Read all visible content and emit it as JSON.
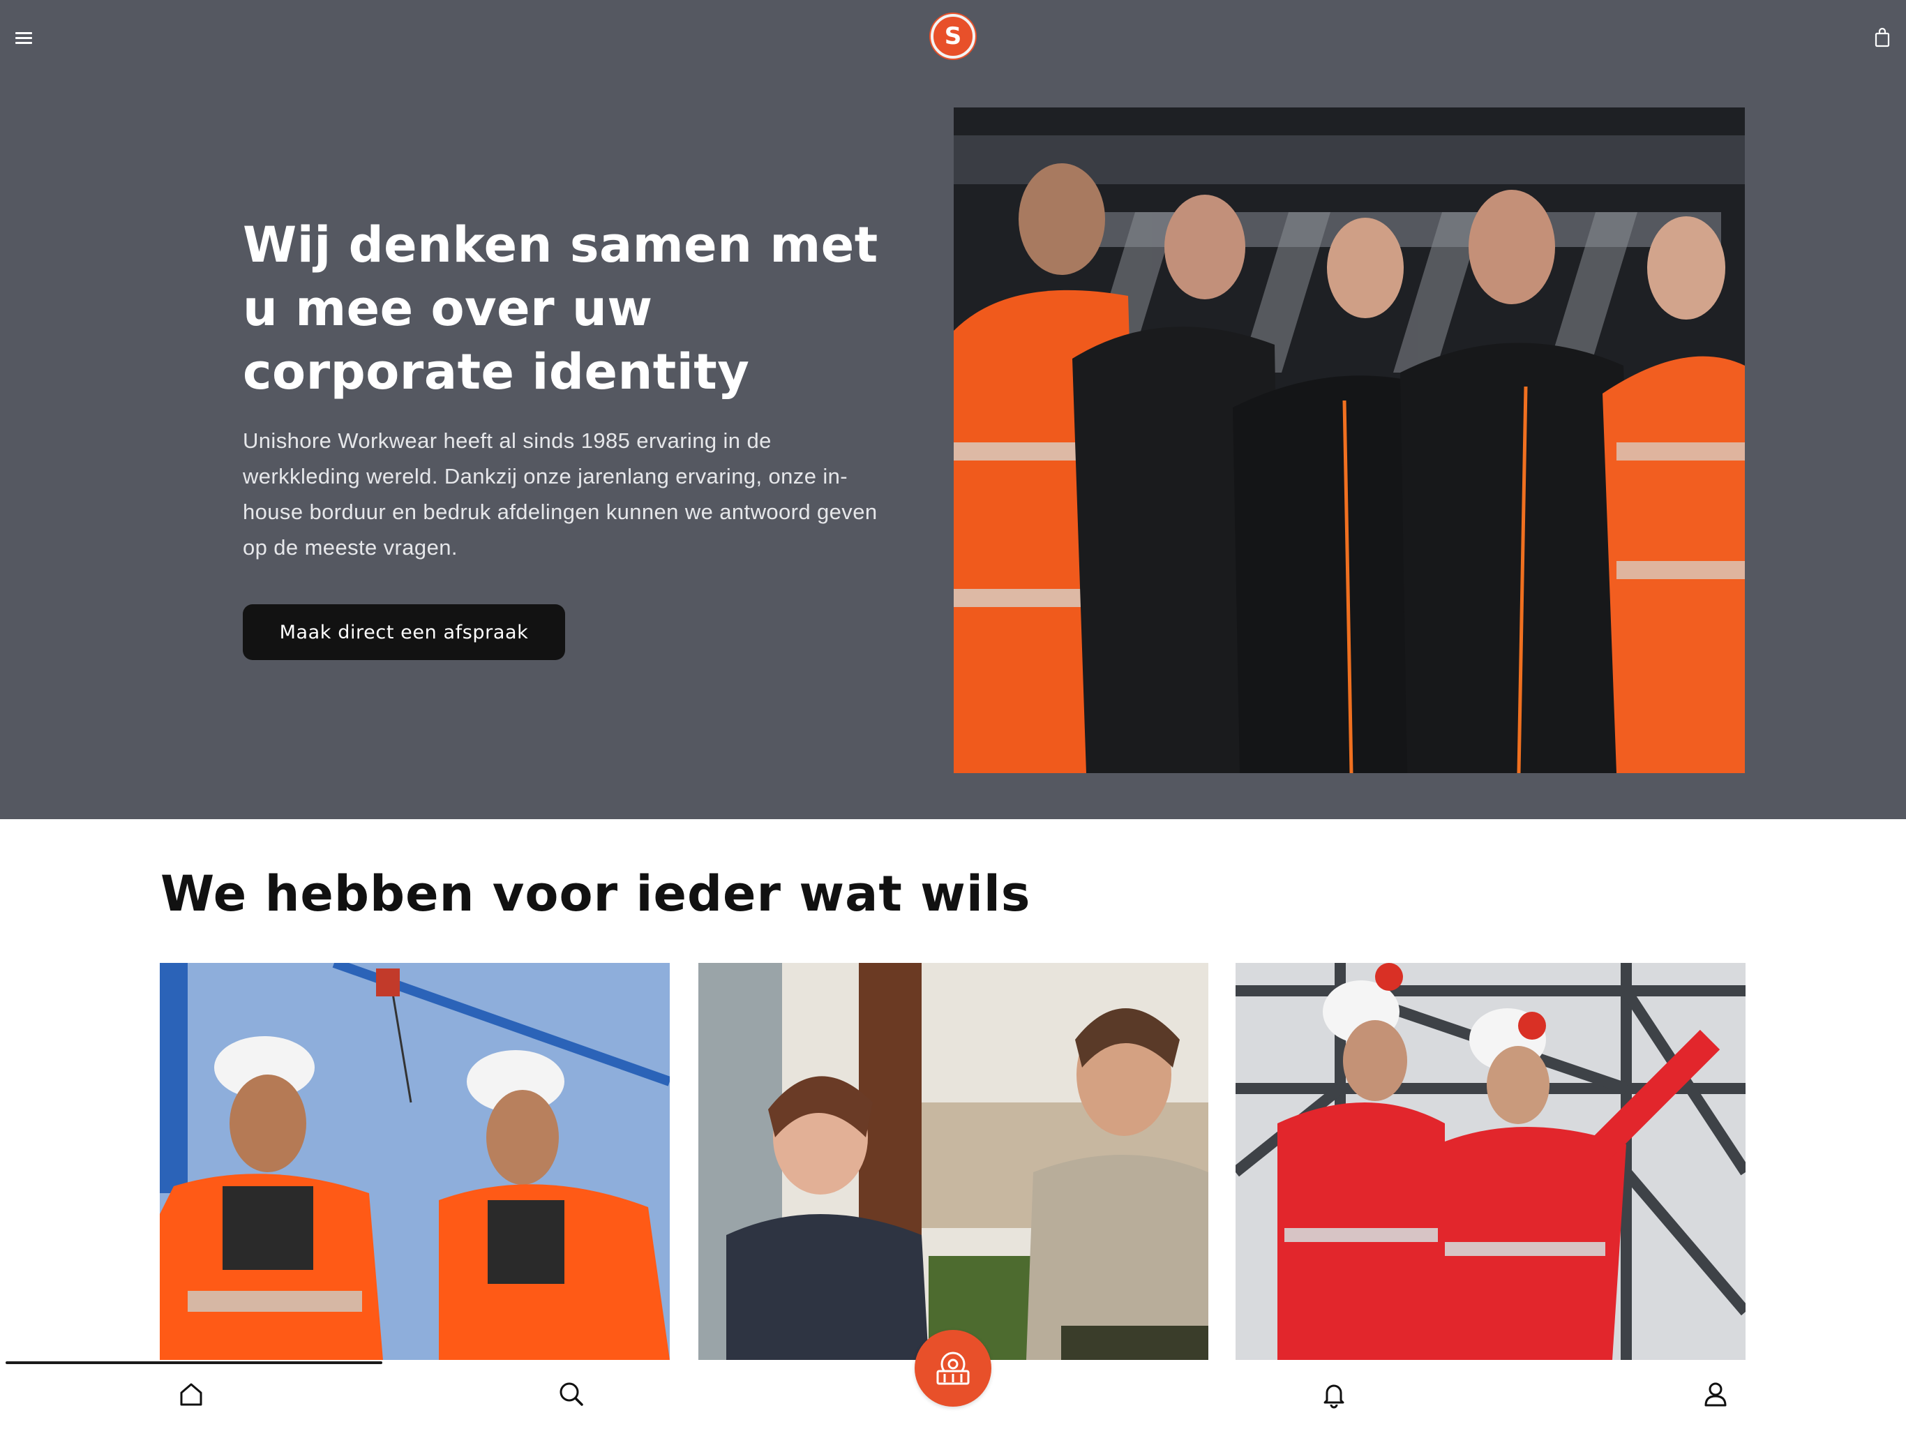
{
  "header": {
    "menu_icon": "hamburger-menu-icon",
    "logo_icon": "unishore-logo",
    "logo_letter": "S",
    "cart_icon": "shopping-bag-icon"
  },
  "hero": {
    "title": "Wij denken samen met u mee over uw corporate identity",
    "text": "Unishore Workwear heeft al sinds 1985 ervaring in de werkkleding wereld. Dankzij onze jarenlang ervaring, onze in-house borduur en bedruk afdelingen kunnen we antwoord geven op de meeste vragen.",
    "button_label": "Maak direct een afspraak",
    "image_icon": "team-workwear-photo"
  },
  "section": {
    "title": "We hebben voor ieder wat wils",
    "cards": [
      {
        "image_icon": "construction-workers-photo"
      },
      {
        "image_icon": "hospitality-staff-photo"
      },
      {
        "image_icon": "industrial-workers-photo"
      }
    ]
  },
  "bottom_nav": {
    "items": [
      {
        "icon": "home-icon"
      },
      {
        "icon": "search-icon"
      },
      {
        "icon": "store-icon"
      },
      {
        "icon": "bell-icon"
      },
      {
        "icon": "user-icon"
      }
    ]
  },
  "colors": {
    "header_bg": "#555861",
    "accent": "#e8502a",
    "button_bg": "#121212"
  }
}
